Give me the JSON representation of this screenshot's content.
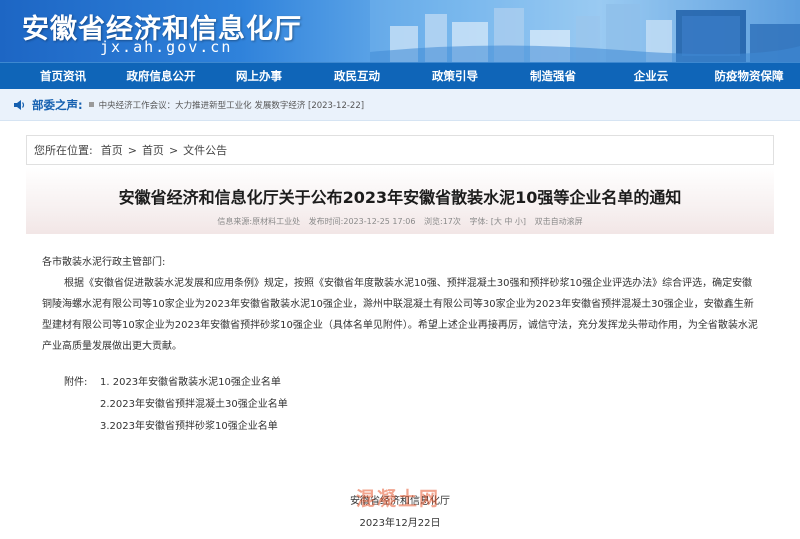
{
  "header": {
    "site_title": "安徽省经济和信息化厅",
    "site_domain": "jx.ah.gov.cn"
  },
  "nav": {
    "items": [
      {
        "label": "首页资讯"
      },
      {
        "label": "政府信息公开"
      },
      {
        "label": "网上办事"
      },
      {
        "label": "政民互动"
      },
      {
        "label": "政策引导"
      },
      {
        "label": "制造强省"
      },
      {
        "label": "企业云"
      },
      {
        "label": "防疫物资保障"
      }
    ]
  },
  "ticker": {
    "label": "部委之声:",
    "item": "中央经济工作会议：大力推进新型工业化 发展数字经济 [2023-12-22]"
  },
  "breadcrumb": {
    "prefix": "您所在位置:",
    "items": [
      "首页",
      "首页",
      "文件公告"
    ],
    "sep": ">"
  },
  "article": {
    "title": "安徽省经济和信息化厅关于公布2023年安徽省散装水泥10强等企业名单的通知",
    "meta": {
      "source_label": "信息来源:",
      "source_value": "原材料工业处",
      "time_label": "发布时间:",
      "time_value": "2023-12-25 17:06",
      "views_label": "浏览:",
      "views_value": "17次",
      "font_label": "字体:",
      "font_value": "[大 中 小]",
      "scroll_label": "双击自动滚屏"
    },
    "salutation": "各市散装水泥行政主管部门:",
    "body": "根据《安徽省促进散装水泥发展和应用条例》规定，按照《安徽省年度散装水泥10强、预拌混凝土30强和预拌砂浆10强企业评选办法》综合评选，确定安徽铜陵海螺水泥有限公司等10家企业为2023年安徽省散装水泥10强企业，滁州中联混凝土有限公司等30家企业为2023年安徽省预拌混凝土30强企业，安徽鑫生新型建材有限公司等10家企业为2023年安徽省预拌砂浆10强企业（具体名单见附件）。希望上述企业再接再厉，诚信守法，充分发挥龙头带动作用，为全省散装水泥产业高质量发展做出更大贡献。",
    "attachments_label": "附件:",
    "attachments": [
      "1. 2023年安徽省散装水泥10强企业名单",
      "2.2023年安徽省预拌混凝土30强企业名单",
      "3.2023年安徽省预拌砂浆10强企业名单"
    ],
    "signature_org": "安徽省经济和信息化厅",
    "signature_date": "2023年12月22日"
  },
  "watermark": "混凝土网",
  "colors": {
    "nav_bg": "#0f65b8",
    "ticker_label": "#1560b0",
    "watermark": "#e65a32"
  }
}
